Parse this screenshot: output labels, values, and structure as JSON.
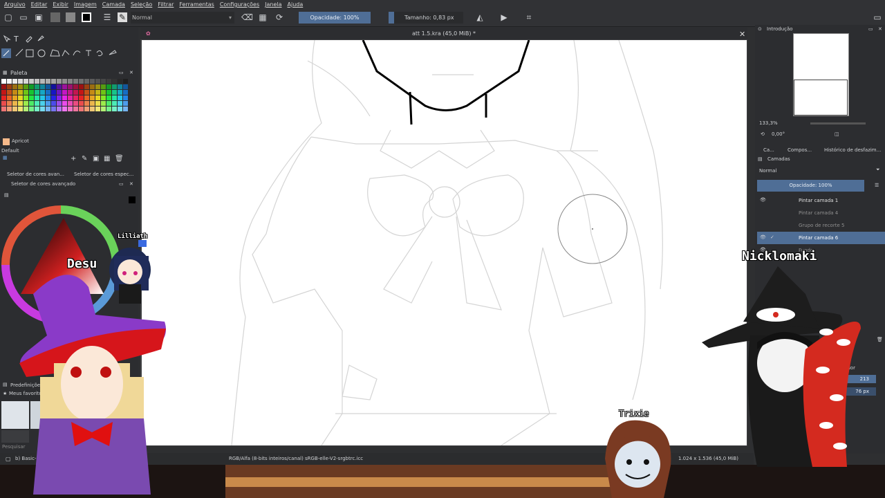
{
  "menu": [
    "Arquivo",
    "Editar",
    "Exibir",
    "Imagem",
    "Camada",
    "Seleção",
    "Filtrar",
    "Ferramentas",
    "Configurações",
    "Janela",
    "Ajuda"
  ],
  "toolbar": {
    "blend_mode": "Normal",
    "opacity_label": "Opacidade: 100%",
    "size_label": "Tamanho: 0,83 px"
  },
  "document": {
    "title": "att 1.5.kra (45,0 MiB) *"
  },
  "palette": {
    "title": "Paleta",
    "current_color_name": "Apricot",
    "set_name": "Default",
    "tab_1": "Seletor de cores avan...",
    "tab_2": "Seletor de cores espec...",
    "advanced_title": "Seletor de cores avançado"
  },
  "presets": {
    "title": "Predefinições de",
    "favorites": "Meus favoritos",
    "search_placeholder": "Pesquisar",
    "current_preset": "b) Basic-"
  },
  "overview": {
    "title": "Introdução",
    "zoom": "133,3%",
    "rotation": "0,00°"
  },
  "dock_tabs": [
    "Ca...",
    "Compos...",
    "Histórico de desfazim..."
  ],
  "layers": {
    "title": "Camadas",
    "blend": "Normal",
    "opacity_label": "Opacidade:  100%",
    "items": [
      {
        "name": "Pintar camada 1",
        "visible": true,
        "selected": false
      },
      {
        "name": "Pintar camada 4",
        "visible": false,
        "selected": false
      },
      {
        "name": "Grupo de recorte 5",
        "visible": false,
        "selected": false
      },
      {
        "name": "Pintar camada 6",
        "visible": true,
        "selected": true
      },
      {
        "name": "Fundo",
        "visible": true,
        "selected": false
      }
    ]
  },
  "stabilizer": {
    "label": "Estabilizador",
    "value_1": "213",
    "value_2": "76 px"
  },
  "status": {
    "color_space": "RGB/Alfa (8-bits inteiros/canal)  sRGB-elle-V2-srgbtrc.icc",
    "dimensions": "1.024 x 1.536 (45,0 MiB)"
  },
  "vtubers": {
    "desu": "Desu",
    "lilliath": "Lilliath",
    "nicklomaki": "Nicklomaki",
    "trixie": "Trixie"
  },
  "colors": {
    "accent": "#4f6e96",
    "panel": "#2c2d30",
    "apricot": "#f6b98a",
    "nick_red": "#d42a1f"
  }
}
